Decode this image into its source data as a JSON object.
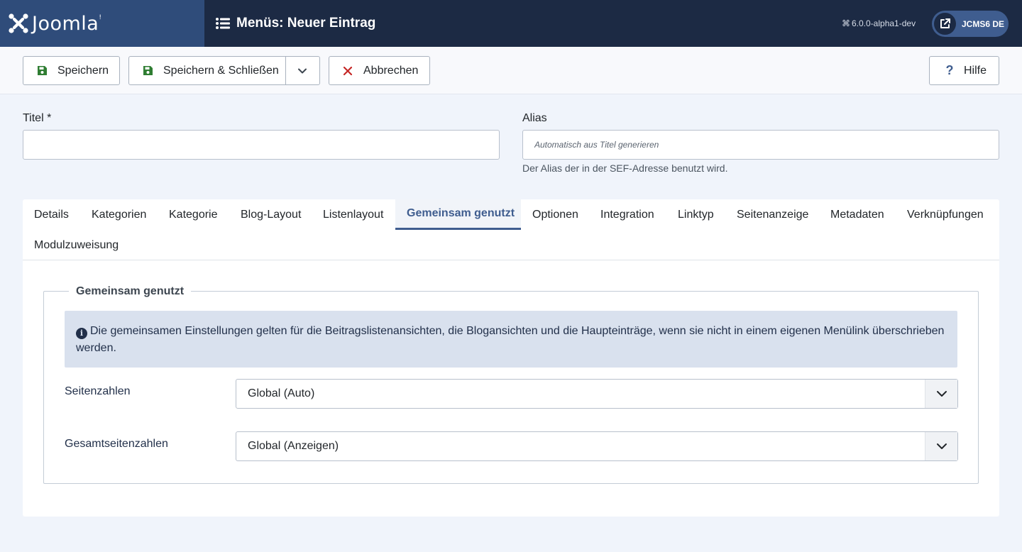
{
  "header": {
    "logo_text": "Joomla!",
    "page_title": "Menüs: Neuer Eintrag",
    "version": "6.0.0-alpha1-dev",
    "site_label": "JCMS6 DE"
  },
  "toolbar": {
    "save_label": "Speichern",
    "save_close_label": "Speichern & Schließen",
    "cancel_label": "Abbrechen",
    "help_label": "Hilfe"
  },
  "form": {
    "title_label": "Titel *",
    "title_value": "",
    "alias_label": "Alias",
    "alias_placeholder": "Automatisch aus Titel generieren",
    "alias_hint": "Der Alias der in der SEF-Adresse benutzt wird."
  },
  "tabs": [
    {
      "label": "Details"
    },
    {
      "label": "Kategorien"
    },
    {
      "label": "Kategorie"
    },
    {
      "label": "Blog-Layout"
    },
    {
      "label": "Listenlayout"
    },
    {
      "label": "Gemeinsam genutzt",
      "active": true
    },
    {
      "label": "Optionen"
    },
    {
      "label": "Integration"
    },
    {
      "label": "Linktyp"
    },
    {
      "label": "Seitenanzeige"
    },
    {
      "label": "Metadaten"
    },
    {
      "label": "Verknüpfungen"
    },
    {
      "label": "Modulzuweisung"
    }
  ],
  "shared": {
    "legend": "Gemeinsam genutzt",
    "alert_text": "Die gemeinsamen Einstellungen gelten für die Beitragslistenansichten, die Blogansichten und die Haupteinträge, wenn sie nicht in einem eigenen Menülink überschrieben werden.",
    "pagination_label": "Seitenzahlen",
    "pagination_value": "Global (Auto)",
    "pagination_results_label": "Gesamtseitenzahlen",
    "pagination_results_value": "Global (Anzeigen)"
  },
  "colors": {
    "header_bg": "#1c2a44",
    "logo_bg": "#2f4c7a",
    "accent": "#3f5d8f",
    "save_icon": "#2f7d32",
    "cancel_icon": "#c52827"
  },
  "icons": {
    "logo": "joomla-logo-icon",
    "menu": "list-icon",
    "version": "command-icon",
    "site": "external-link-icon",
    "save": "floppy-disk-icon",
    "dropdown": "chevron-down-icon",
    "cancel": "close-icon",
    "help": "question-icon",
    "info": "info-icon"
  }
}
